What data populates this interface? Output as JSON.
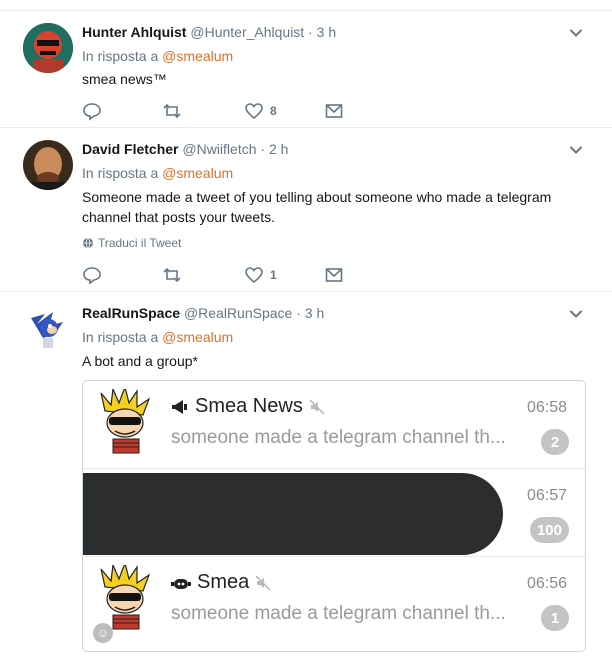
{
  "tweets": [
    {
      "name": "Hunter Ahlquist",
      "handle": "@Hunter_Ahlquist",
      "dot": "·",
      "time": "3 h",
      "reply_prefix": "In risposta a",
      "reply_to": "@smealum",
      "text": "smea news™",
      "actions": {
        "reply_count": "",
        "retweet_count": "",
        "like_count": "8"
      }
    },
    {
      "name": "David Fletcher",
      "handle": "@Nwiifletch",
      "dot": "·",
      "time": "2 h",
      "reply_prefix": "In risposta a",
      "reply_to": "@smealum",
      "text_line1": "Someone made a tweet of you telling about someone who made a telegram",
      "text_line2": "channel that posts your tweets.",
      "translate_label": "Traduci il Tweet",
      "actions": {
        "reply_count": "",
        "retweet_count": "",
        "like_count": "1"
      }
    },
    {
      "name": "RealRunSpace",
      "handle": "@RealRunSpace",
      "dot": "·",
      "time": "3 h",
      "reply_prefix": "In risposta a",
      "reply_to": "@smealum",
      "text": "A bot and a group*"
    }
  ],
  "telegram_chats": [
    {
      "name": "Smea News",
      "time": "06:58",
      "message": "someone made a telegram channel th...",
      "unread": "2",
      "icon": "megaphone-icon",
      "muted": true
    },
    {
      "name": "",
      "time": "06:57",
      "message": "",
      "unread": "100",
      "redacted": true
    },
    {
      "name": "Smea",
      "time": "06:56",
      "message": "someone made a telegram channel th...",
      "unread": "1",
      "icon": "bot-icon",
      "muted": true
    }
  ],
  "colors": {
    "mention": "#e0702a",
    "muted_text": "#657786",
    "border": "#e6ecf0"
  }
}
